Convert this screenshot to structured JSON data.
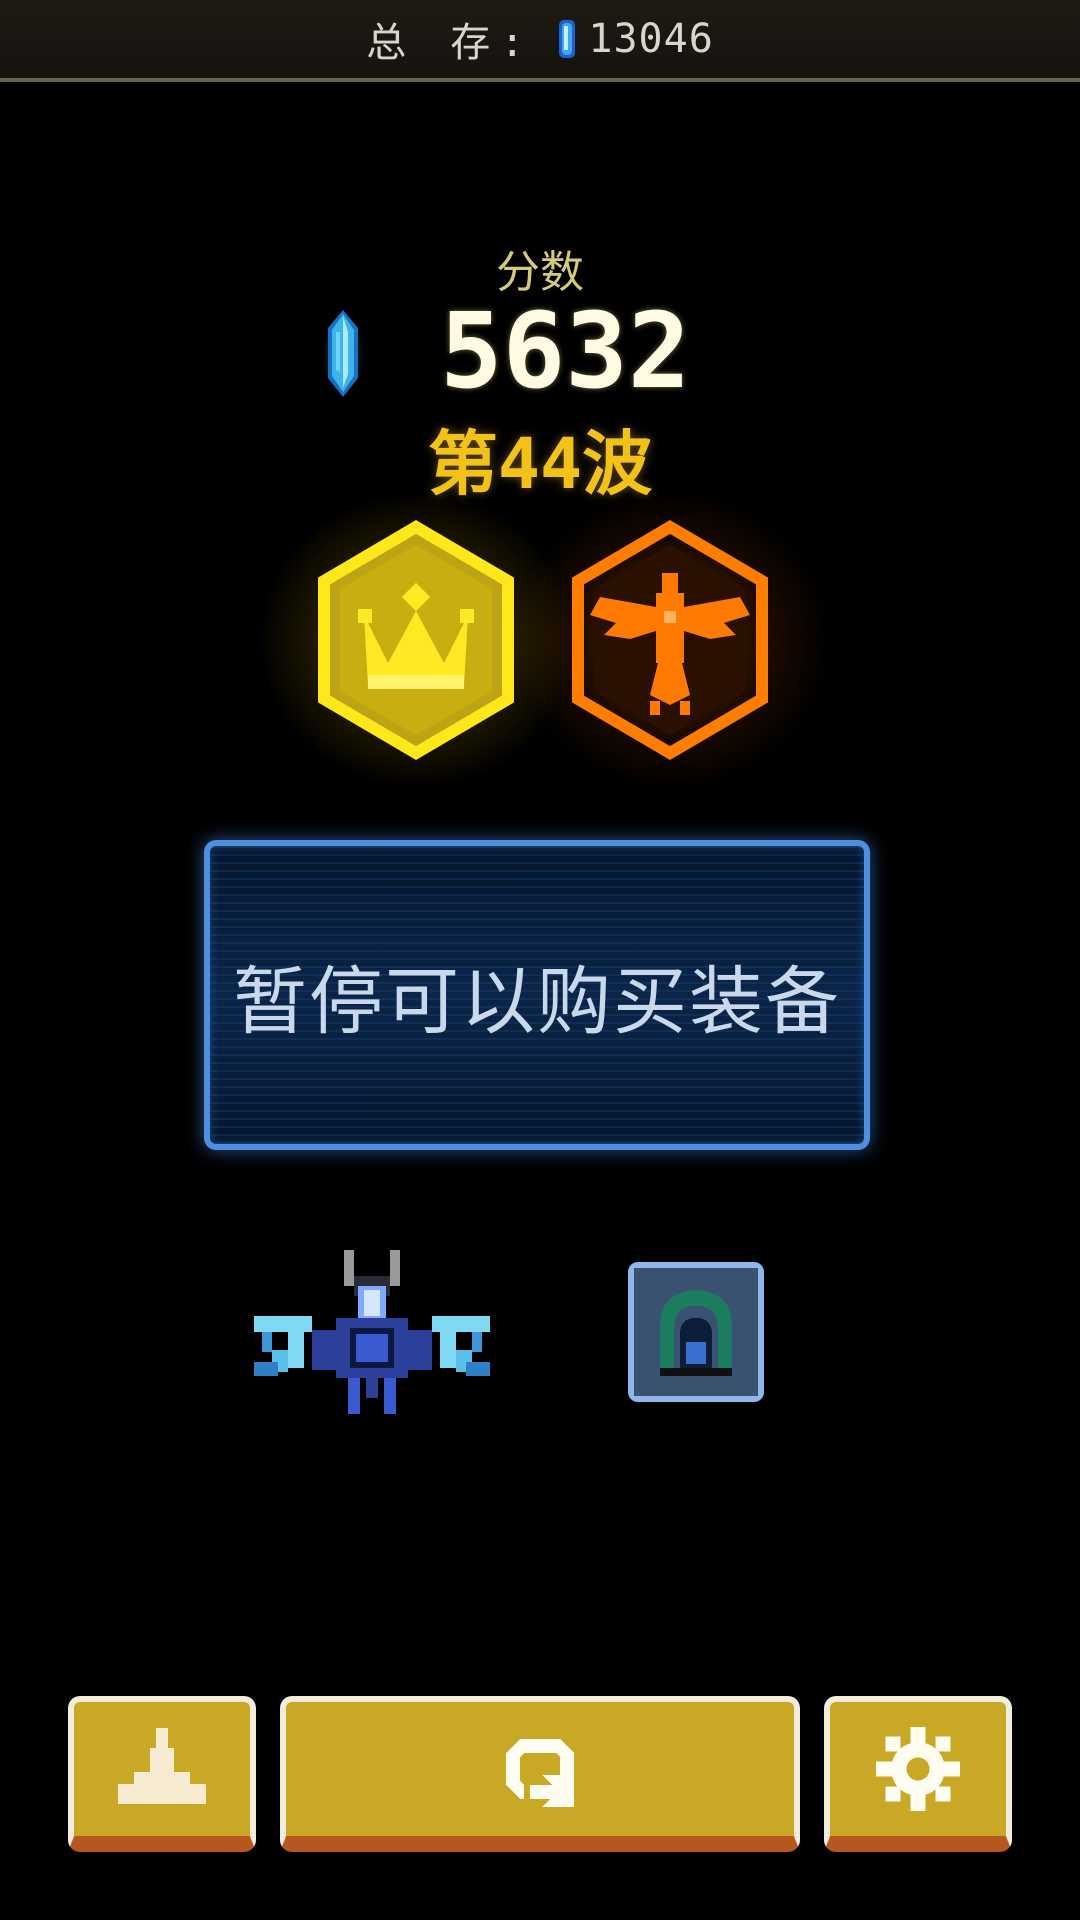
{
  "bank": {
    "label": "总 存:",
    "total": "13046",
    "icon": "crystal-gem-icon"
  },
  "score": {
    "label": "分数",
    "value": "5632",
    "icon": "crystal-gem-icon"
  },
  "wave": {
    "label": "第44波"
  },
  "medals": [
    {
      "icon": "crown-medal-icon",
      "color": "#f5e11a"
    },
    {
      "icon": "eagle-medal-icon",
      "color": "#ff7a00"
    }
  ],
  "notice": {
    "text": "暂停可以购买装备"
  },
  "ship": {
    "icon": "player-spaceship-icon"
  },
  "equipment": {
    "icon": "shield-equipment-icon"
  },
  "buttons": [
    {
      "icon": "ship-select-icon"
    },
    {
      "icon": "restart-icon"
    },
    {
      "icon": "gear-icon"
    }
  ],
  "colors": {
    "button_fill": "#c9a826",
    "button_shadow": "#b5571e",
    "panel_border": "#4f8fe0",
    "wave_text": "#f2c21b"
  }
}
